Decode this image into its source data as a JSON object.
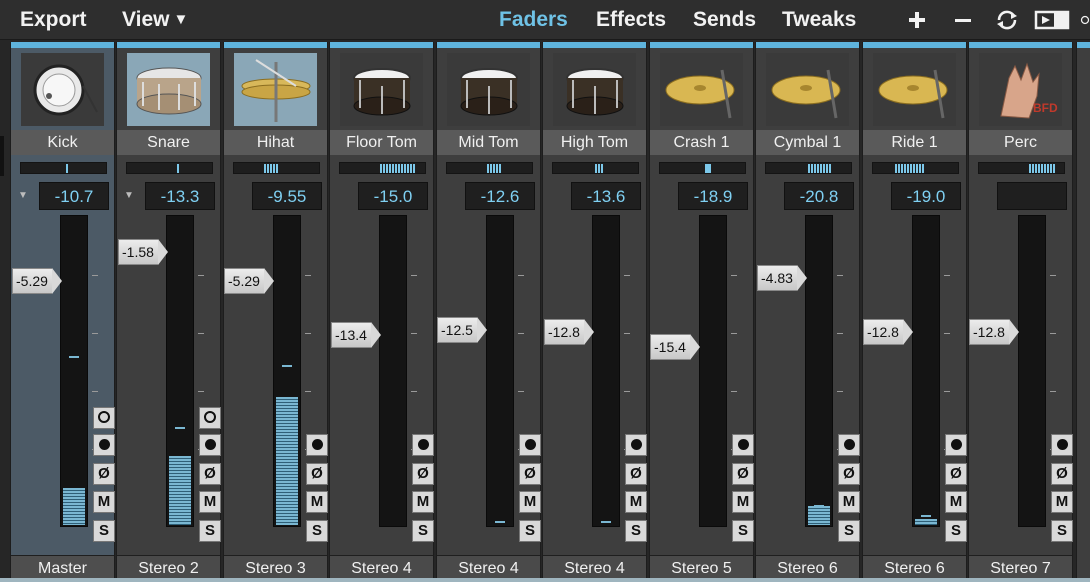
{
  "menu": {
    "export": "Export",
    "view": "View",
    "view_caret": "▼"
  },
  "tabs": [
    {
      "label": "Faders",
      "active": true
    },
    {
      "label": "Effects",
      "active": false
    },
    {
      "label": "Sends",
      "active": false
    },
    {
      "label": "Tweaks",
      "active": false
    }
  ],
  "toolbar_icons": [
    "plus-icon",
    "minus-icon",
    "refresh-icon",
    "window-toggle-icon"
  ],
  "colors": {
    "accent": "#6fc2e6",
    "meter": "#7ab7d2",
    "volume_text": "#7fd0f2"
  },
  "channels": [
    {
      "name": "Kick",
      "icon": "kick-drum-icon",
      "volume": "-10.7",
      "fader": "-5.29",
      "output": "Master",
      "has_triangle": true,
      "top_button": "record-monitor",
      "meter": 0.12,
      "peak": 0.54
    },
    {
      "name": "Snare",
      "icon": "snare-drum-icon",
      "volume": "-13.3",
      "fader": "-1.58",
      "output": "Stereo 2",
      "has_triangle": true,
      "top_button": "record-monitor",
      "meter": 0.22,
      "peak": 0.31
    },
    {
      "name": "Hihat",
      "icon": "hihat-icon",
      "volume": "-9.55",
      "fader": "-5.29",
      "output": "Stereo 3",
      "has_triangle": false,
      "top_button": "none",
      "meter": 0.41,
      "peak": 0.51
    },
    {
      "name": "Floor Tom",
      "icon": "floor-tom-icon",
      "volume": "-15.0",
      "fader": "-13.4",
      "output": "Stereo 4",
      "has_triangle": false,
      "top_button": "none",
      "meter": 0.0,
      "peak": null
    },
    {
      "name": "Mid Tom",
      "icon": "mid-tom-icon",
      "volume": "-12.6",
      "fader": "-12.5",
      "output": "Stereo 4",
      "has_triangle": false,
      "top_button": "none",
      "meter": 0.0,
      "peak": 0.01
    },
    {
      "name": "High Tom",
      "icon": "high-tom-icon",
      "volume": "-13.6",
      "fader": "-12.8",
      "output": "Stereo 4",
      "has_triangle": false,
      "top_button": "none",
      "meter": 0.0,
      "peak": 0.01
    },
    {
      "name": "Crash 1",
      "icon": "crash-cymbal-icon",
      "volume": "-18.9",
      "fader": "-15.4",
      "output": "Stereo 5",
      "has_triangle": false,
      "top_button": "none",
      "meter": 0.0,
      "peak": null
    },
    {
      "name": "Cymbal 1",
      "icon": "cymbal-icon",
      "volume": "-20.8",
      "fader": "-4.83",
      "output": "Stereo 6",
      "has_triangle": false,
      "top_button": "none",
      "meter": 0.06,
      "peak": 0.06
    },
    {
      "name": "Ride 1",
      "icon": "ride-cymbal-icon",
      "volume": "-19.0",
      "fader": "-12.8",
      "output": "Stereo 6",
      "has_triangle": false,
      "top_button": "none",
      "meter": 0.02,
      "peak": 0.03
    },
    {
      "name": "Perc",
      "icon": "percussion-icon",
      "volume": "",
      "fader": "-12.8",
      "output": "Stereo 7",
      "has_triangle": false,
      "top_button": "none",
      "meter": 0.0,
      "peak": null
    }
  ],
  "button_labels": {
    "phase": "Ø",
    "mute": "M",
    "solo": "S"
  }
}
